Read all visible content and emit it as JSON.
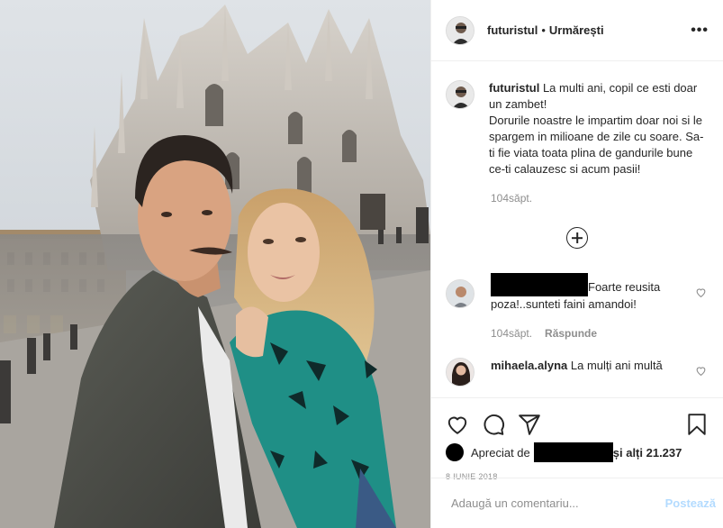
{
  "post": {
    "image_alt": "selfie in front of a gothic cathedral"
  },
  "header": {
    "username": "futuristul",
    "separator": "•",
    "follow_label": "Urmărești",
    "more_label": "•••"
  },
  "caption": {
    "username": "futuristul",
    "text": "La multi ani, copil ce esti doar un zambet!\nDorurile noastre le impartim doar noi si le spargem in milioane de zile cu soare. Sa-ti fie viata toata plina de gandurile bune ce-ti calauzesc si acum pasii!",
    "age": "104săpt."
  },
  "comments": [
    {
      "text": "Foarte reusita poza!..sunteti faini amandoi!",
      "age": "104săpt.",
      "reply_label": "Răspunde"
    },
    {
      "username": "mihaela.alyna",
      "text": "La mulți ani multă"
    }
  ],
  "likes": {
    "prefix": "Apreciat de",
    "suffix": "și alți 21.237"
  },
  "date": "8 IUNIE 2018",
  "add_comment": {
    "placeholder": "Adaugă un comentariu...",
    "post_label": "Postează"
  },
  "icons": {
    "like": "heart-icon",
    "comment": "comment-icon",
    "share": "share-icon",
    "save": "bookmark-icon",
    "load_more": "plus-circle-icon"
  },
  "colors": {
    "text": "#262626",
    "muted": "#8e8e8e",
    "border": "#efefef",
    "post_button": "#b3dbff"
  }
}
